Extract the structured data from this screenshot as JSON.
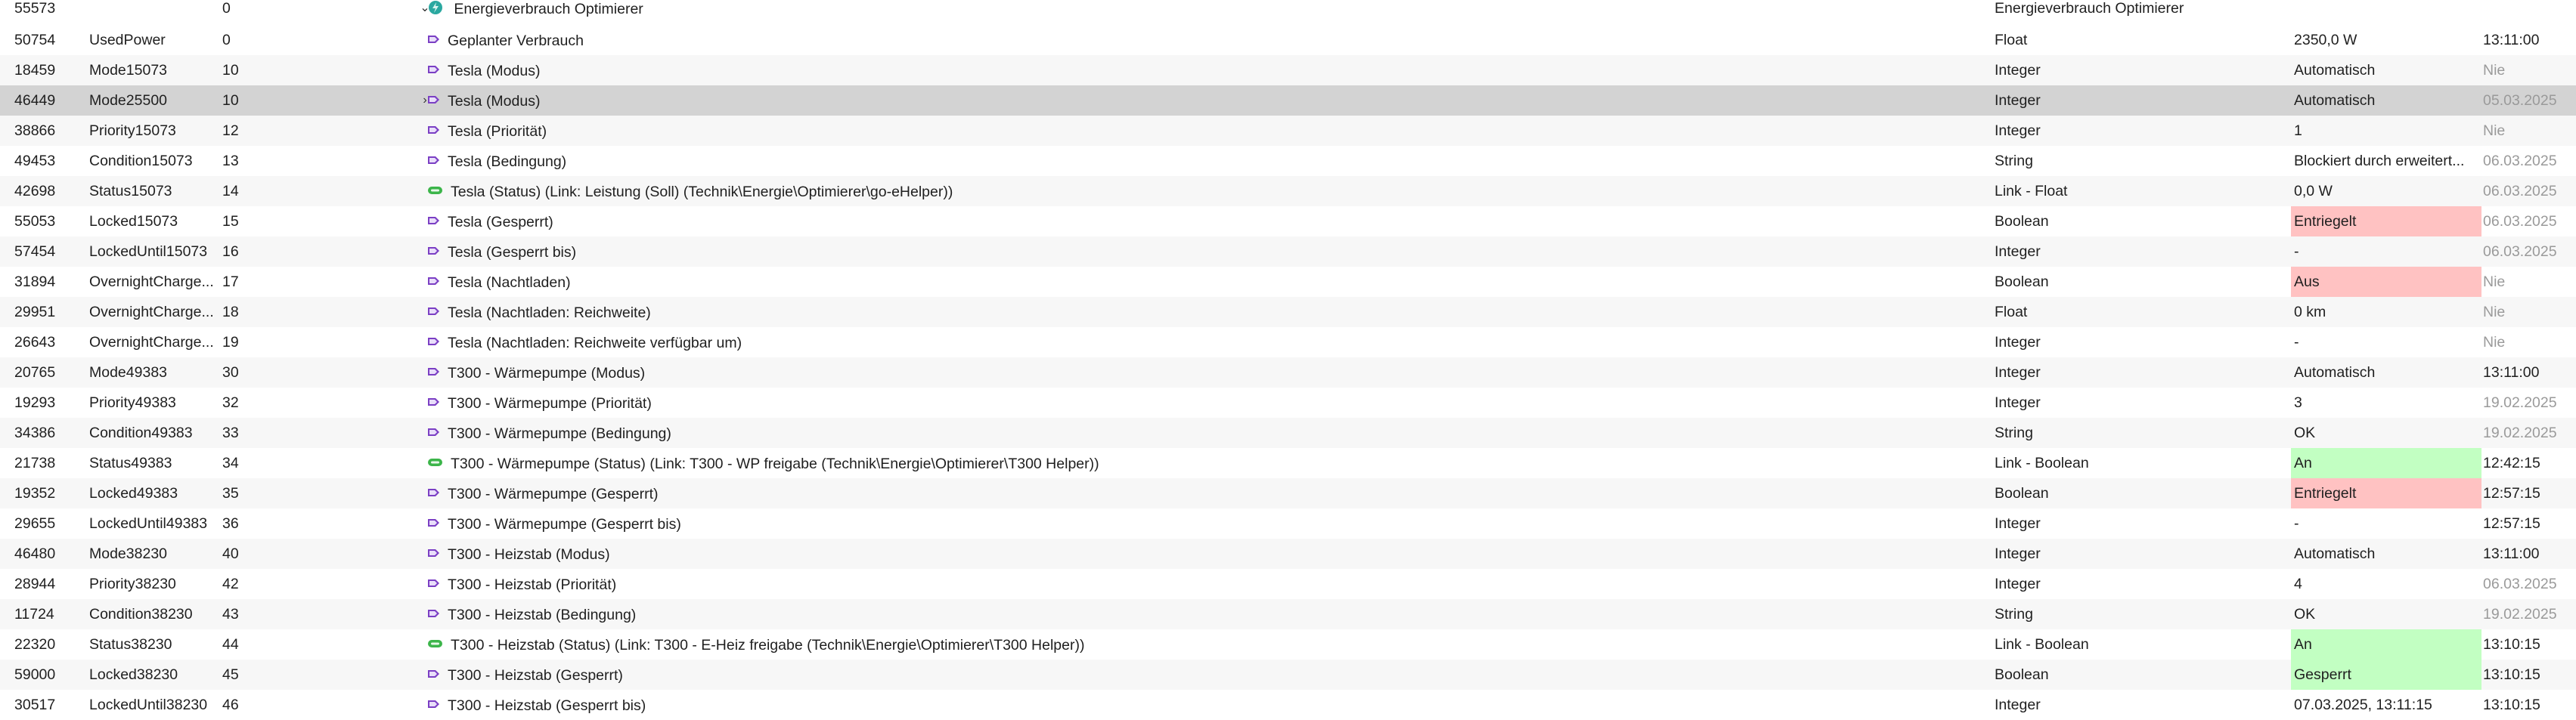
{
  "colors": {
    "locked_red": "#ffc2c2",
    "ok_green": "#c2ffc2",
    "selected_row": "#d3d3d3",
    "icon_purple": "#7b3fc4",
    "icon_green": "#3cb54a"
  },
  "header_row": {
    "id": "55573",
    "position": "0",
    "name": "Energieverbrauch Optimierer",
    "type": "Energieverbrauch Optimierer",
    "expand_icon": "chevron-down-icon",
    "icon": "energy-category-icon"
  },
  "rows": [
    {
      "id": "50754",
      "ident": "UsedPower",
      "position": "0",
      "icon": "variable-icon",
      "name": "Geplanter Verbrauch",
      "type": "Float",
      "value": "2350,0 W",
      "time": "13:11:00"
    },
    {
      "id": "18459",
      "ident": "Mode15073",
      "position": "10",
      "icon": "variable-icon",
      "name": "Tesla (Modus)",
      "type": "Integer",
      "value": "Automatisch",
      "time": "Nie"
    },
    {
      "id": "46449",
      "ident": "Mode25500",
      "position": "10",
      "icon": "variable-icon",
      "name": "Tesla (Modus)",
      "type": "Integer",
      "value": "Automatisch",
      "time": "05.03.2025",
      "expand_icon": "chevron-right-icon"
    },
    {
      "id": "38866",
      "ident": "Priority15073",
      "position": "12",
      "icon": "variable-icon",
      "name": "Tesla (Priorität)",
      "type": "Integer",
      "value": "1",
      "time": "Nie"
    },
    {
      "id": "49453",
      "ident": "Condition15073",
      "position": "13",
      "icon": "variable-icon",
      "name": "Tesla (Bedingung)",
      "type": "String",
      "value": "Blockiert durch erweitert...",
      "time": "06.03.2025"
    },
    {
      "id": "42698",
      "ident": "Status15073",
      "position": "14",
      "icon": "link-icon",
      "name": "Tesla (Status) (Link: Leistung (Soll) (Technik\\Energie\\Optimierer\\go-eHelper))",
      "type": "Link - Float",
      "value": "0,0 W",
      "time": "06.03.2025"
    },
    {
      "id": "55053",
      "ident": "Locked15073",
      "position": "15",
      "icon": "variable-icon",
      "name": "Tesla (Gesperrt)",
      "type": "Boolean",
      "value": "Entriegelt",
      "time": "06.03.2025"
    },
    {
      "id": "57454",
      "ident": "LockedUntil15073",
      "position": "16",
      "icon": "variable-icon",
      "name": "Tesla (Gesperrt bis)",
      "type": "Integer",
      "value": "-",
      "time": "06.03.2025"
    },
    {
      "id": "31894",
      "ident": "OvernightCharge...",
      "position": "17",
      "icon": "variable-icon",
      "name": "Tesla (Nachtladen)",
      "type": "Boolean",
      "value": "Aus",
      "time": "Nie"
    },
    {
      "id": "29951",
      "ident": "OvernightCharge...",
      "position": "18",
      "icon": "variable-icon",
      "name": "Tesla (Nachtladen: Reichweite)",
      "type": "Float",
      "value": "0 km",
      "time": "Nie"
    },
    {
      "id": "26643",
      "ident": "OvernightCharge...",
      "position": "19",
      "icon": "variable-icon",
      "name": "Tesla (Nachtladen: Reichweite verfügbar um)",
      "type": "Integer",
      "value": "-",
      "time": "Nie"
    },
    {
      "id": "20765",
      "ident": "Mode49383",
      "position": "30",
      "icon": "variable-icon",
      "name": "T300 - Wärmepumpe (Modus)",
      "type": "Integer",
      "value": "Automatisch",
      "time": "13:11:00"
    },
    {
      "id": "19293",
      "ident": "Priority49383",
      "position": "32",
      "icon": "variable-icon",
      "name": "T300 - Wärmepumpe (Priorität)",
      "type": "Integer",
      "value": "3",
      "time": "19.02.2025"
    },
    {
      "id": "34386",
      "ident": "Condition49383",
      "position": "33",
      "icon": "variable-icon",
      "name": "T300 - Wärmepumpe (Bedingung)",
      "type": "String",
      "value": "OK",
      "time": "19.02.2025"
    },
    {
      "id": "21738",
      "ident": "Status49383",
      "position": "34",
      "icon": "link-icon",
      "name": "T300 - Wärmepumpe (Status) (Link: T300 - WP freigabe (Technik\\Energie\\Optimierer\\T300 Helper))",
      "type": "Link - Boolean",
      "value": "An",
      "time": "12:42:15"
    },
    {
      "id": "19352",
      "ident": "Locked49383",
      "position": "35",
      "icon": "variable-icon",
      "name": "T300 - Wärmepumpe (Gesperrt)",
      "type": "Boolean",
      "value": "Entriegelt",
      "time": "12:57:15"
    },
    {
      "id": "29655",
      "ident": "LockedUntil49383",
      "position": "36",
      "icon": "variable-icon",
      "name": "T300 - Wärmepumpe (Gesperrt bis)",
      "type": "Integer",
      "value": "-",
      "time": "12:57:15"
    },
    {
      "id": "46480",
      "ident": "Mode38230",
      "position": "40",
      "icon": "variable-icon",
      "name": "T300 - Heizstab (Modus)",
      "type": "Integer",
      "value": "Automatisch",
      "time": "13:11:00"
    },
    {
      "id": "28944",
      "ident": "Priority38230",
      "position": "42",
      "icon": "variable-icon",
      "name": "T300 - Heizstab (Priorität)",
      "type": "Integer",
      "value": "4",
      "time": "06.03.2025"
    },
    {
      "id": "11724",
      "ident": "Condition38230",
      "position": "43",
      "icon": "variable-icon",
      "name": "T300 - Heizstab (Bedingung)",
      "type": "String",
      "value": "OK",
      "time": "19.02.2025"
    },
    {
      "id": "22320",
      "ident": "Status38230",
      "position": "44",
      "icon": "link-icon",
      "name": "T300 - Heizstab (Status) (Link: T300 - E-Heiz freigabe (Technik\\Energie\\Optimierer\\T300 Helper))",
      "type": "Link - Boolean",
      "value": "An",
      "time": "13:10:15"
    },
    {
      "id": "59000",
      "ident": "Locked38230",
      "position": "45",
      "icon": "variable-icon",
      "name": "T300 - Heizstab (Gesperrt)",
      "type": "Boolean",
      "value": "Gesperrt",
      "time": "13:10:15"
    },
    {
      "id": "30517",
      "ident": "LockedUntil38230",
      "position": "46",
      "icon": "variable-icon",
      "name": "T300 - Heizstab (Gesperrt bis)",
      "type": "Integer",
      "value": "07.03.2025, 13:11:15",
      "time": "13:10:15"
    }
  ]
}
